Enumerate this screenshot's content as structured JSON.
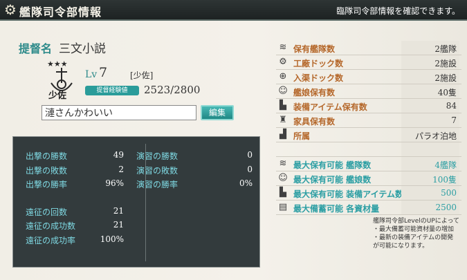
{
  "header": {
    "title": "艦隊司令部情報",
    "description": "臨隊司令部情報を確認できます。",
    "gear_icon": "gear-icon"
  },
  "admiral": {
    "label": "提督名",
    "name": "三文小説",
    "lv_label": "Lv",
    "level": "7",
    "rank": "[少佐]",
    "rank_badge": "少佐",
    "exp_label": "提督経験値",
    "exp_value": "2523/2800",
    "comment": "漣さんかわいい",
    "edit_label": "編集"
  },
  "battle": {
    "sortie_wins_label": "出撃の勝数",
    "sortie_wins": "49",
    "sortie_losses_label": "出撃の敗数",
    "sortie_losses": "2",
    "sortie_rate_label": "出撃の勝率",
    "sortie_rate": "96%",
    "exercise_wins_label": "演習の勝数",
    "exercise_wins": "0",
    "exercise_losses_label": "演習の敗数",
    "exercise_losses": "0",
    "exercise_rate_label": "演習の勝率",
    "exercise_rate": "0%",
    "expedition_count_label": "遠征の回数",
    "expedition_count": "21",
    "expedition_success_label": "遠征の成功数",
    "expedition_success": "21",
    "expedition_rate_label": "遠征の成功率",
    "expedition_rate": "100%"
  },
  "facilities": {
    "fleets_label": "保有艦隊数",
    "fleets": "2艦隊",
    "arsenal_label": "工廠ドック数",
    "arsenal": "2施設",
    "repair_label": "入渠ドック数",
    "repair": "2施設",
    "girls_label": "艦娘保有数",
    "girls": "40隻",
    "equip_label": "装備アイテム保有数",
    "equip": "84",
    "furniture_label": "家具保有数",
    "furniture": "7",
    "base_label": "所属",
    "base": "パラオ泊地"
  },
  "limits": {
    "max_fleets_label": "最大保有可能 艦隊数",
    "max_fleets": "4艦隊",
    "max_girls_label": "最大保有可能 艦娘数",
    "max_girls": "100隻",
    "max_equip_label": "最大保有可能 装備アイテム数",
    "max_equip": "500",
    "max_resources_label": "最大備蓄可能 各資材量",
    "max_resources": "2500"
  },
  "note": {
    "line1": "艦隊司令部LevelのUPによって",
    "line2": "・最大備蓄可能資材量の増加",
    "line3": "・最新の装備アイテムの開発",
    "line4": "が可能になります。"
  }
}
